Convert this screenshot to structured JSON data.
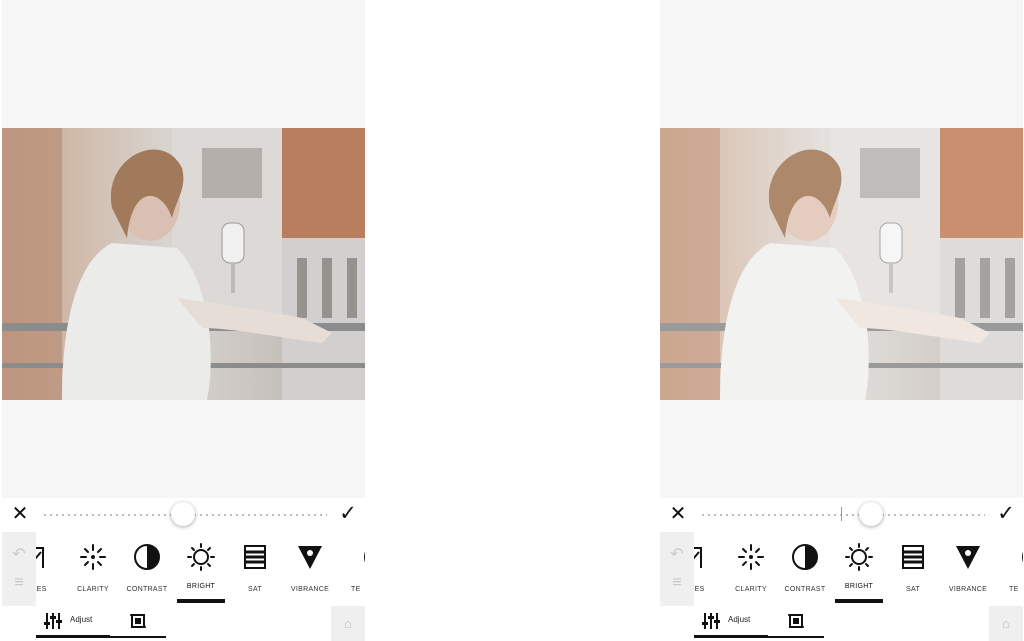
{
  "editor_left": {
    "slider": {
      "value_fraction": 0.5
    },
    "tools": [
      {
        "label": "IVES",
        "icon": "curves-icon"
      },
      {
        "label": "CLARITY",
        "icon": "clarity-icon"
      },
      {
        "label": "CONTRAST",
        "icon": "contrast-icon"
      },
      {
        "label": "BRIGHT",
        "icon": "brightness-icon",
        "active": true
      },
      {
        "label": "SAT",
        "icon": "saturation-icon"
      },
      {
        "label": "VIBRANCE",
        "icon": "vibrance-icon"
      },
      {
        "label": "TE",
        "icon": "temperature-icon"
      }
    ],
    "bottom": {
      "adjust_label": "Adjust"
    }
  },
  "editor_right": {
    "slider": {
      "value_fraction": 0.6
    },
    "tools": [
      {
        "label": "IVES",
        "icon": "curves-icon"
      },
      {
        "label": "CLARITY",
        "icon": "clarity-icon"
      },
      {
        "label": "CONTRAST",
        "icon": "contrast-icon"
      },
      {
        "label": "BRIGHT",
        "icon": "brightness-icon",
        "active": true
      },
      {
        "label": "SAT",
        "icon": "saturation-icon"
      },
      {
        "label": "VIBRANCE",
        "icon": "vibrance-icon"
      },
      {
        "label": "TE",
        "icon": "temperature-icon"
      }
    ],
    "bottom": {
      "adjust_label": "Adjust"
    }
  },
  "colors": {
    "accent": "#111111",
    "panel": "#f6f6f6",
    "temperature": "#7d8fc9"
  }
}
